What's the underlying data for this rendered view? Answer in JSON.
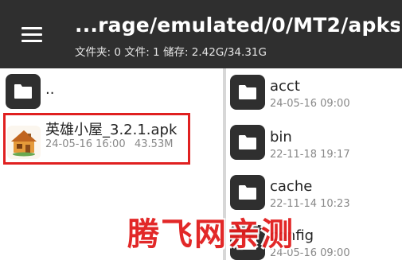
{
  "toolbar": {
    "menu_icon": "hamburger-menu-icon",
    "path_title": "...rage/emulated/0/MT2/apks/",
    "path_info": "文件夹: 0  文件: 1  储存: 2.42G/34.31G"
  },
  "left_pane": {
    "parent_item": {
      "name": "..",
      "icon": "folder-icon"
    },
    "apk_item": {
      "name": "英雄小屋_3.2.1.apk",
      "date": "24-05-16 16:00",
      "size": "43.53M",
      "icon": "house-app-icon"
    }
  },
  "right_pane": {
    "items": [
      {
        "name": "acct",
        "date": "24-05-16 09:00",
        "icon": "folder-icon"
      },
      {
        "name": "bin",
        "date": "22-11-18 19:17",
        "icon": "folder-icon"
      },
      {
        "name": "cache",
        "date": "22-11-14 10:23",
        "icon": "folder-icon"
      },
      {
        "name": "config",
        "date": "24-05-16 09:00",
        "icon": "folder-icon"
      }
    ]
  },
  "watermark": {
    "text": "腾飞网亲测"
  },
  "colors": {
    "toolbar_bg": "#2f2f2f",
    "folder_tile": "#2f2f2f",
    "highlight_border": "#e02020",
    "watermark": "#e11d1d",
    "divider": "#d7d7d7"
  }
}
